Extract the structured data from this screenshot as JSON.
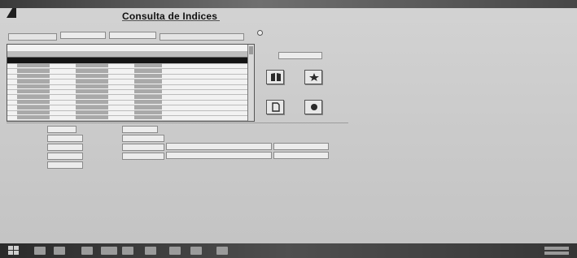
{
  "window": {
    "title": "Consulta de Indices"
  },
  "top_fields": {
    "field1": "",
    "field2": "",
    "field3": "",
    "field4": ""
  },
  "options": {
    "label1": "",
    "label2": "",
    "label3": ""
  },
  "grid": {
    "caption": "",
    "columns": [
      "",
      "",
      ""
    ],
    "row_count": 12
  },
  "buttons": [
    {
      "icon": "book-icon"
    },
    {
      "icon": "star-icon"
    },
    {
      "icon": "document-icon"
    },
    {
      "icon": "record-icon"
    }
  ],
  "detail": {
    "labels": [
      "",
      "",
      "",
      "",
      "",
      "",
      "",
      "",
      ""
    ],
    "values": [
      "",
      "",
      "",
      "",
      "",
      "",
      "",
      "",
      ""
    ]
  },
  "right_note": "",
  "taskbar": {
    "clock": ""
  }
}
